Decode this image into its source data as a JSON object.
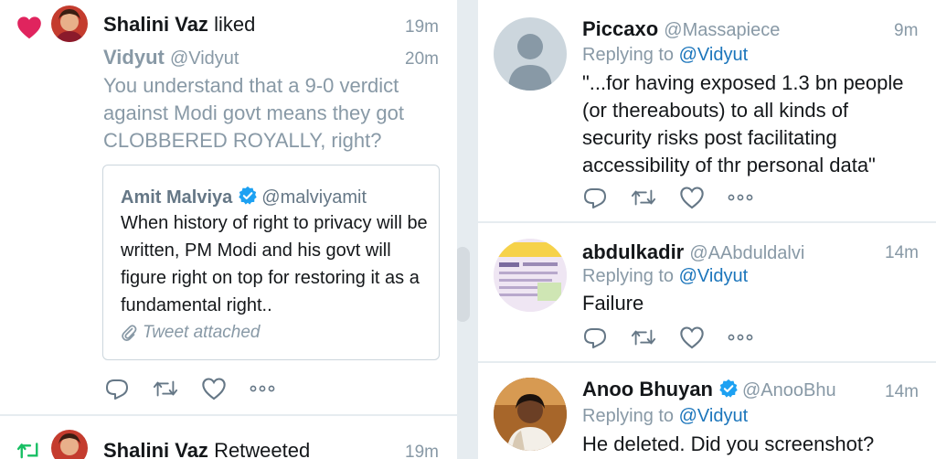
{
  "left": {
    "notification": {
      "user": "Shalini Vaz",
      "action": "liked",
      "time": "19m"
    },
    "tweet": {
      "name": "Vidyut",
      "handle": "@Vidyut",
      "time": "20m",
      "text": "You understand that a 9-0 verdict against Modi govt means they got CLOBBERED ROYALLY, right?"
    },
    "quote": {
      "name": "Amit Malviya",
      "handle": "@malviyamit",
      "text": "When history of right to privacy will be written, PM Modi and his govt will figure right on top for restoring it as a fundamental right..",
      "attachment": "Tweet attached"
    },
    "next_notification": {
      "user": "Shalini Vaz",
      "action": "Retweeted",
      "time": "19m"
    }
  },
  "right": {
    "replies": [
      {
        "name": "Piccaxo",
        "handle": "@Massapiece",
        "time": "9m",
        "replying_label": "Replying to",
        "replying_to": "@Vidyut",
        "text": "\"...for having exposed 1.3 bn people (or thereabouts) to all kinds of security risks post facilitating accessibility of thr personal data\""
      },
      {
        "name": "abdulkadir",
        "handle": "@AAbduldalvi",
        "time": "14m",
        "replying_label": "Replying to",
        "replying_to": "@Vidyut",
        "text": "Failure"
      },
      {
        "name": "Anoo Bhuyan",
        "handle": "@AnooBhu",
        "time": "14m",
        "replying_label": "Replying to",
        "replying_to": "@Vidyut",
        "text": "He deleted. Did you screenshot?"
      }
    ]
  },
  "colors": {
    "like": "#e0245e",
    "retweet": "#17bf63",
    "verified": "#1da1f2",
    "link": "#1b75bb",
    "dim": "#8899a6"
  }
}
